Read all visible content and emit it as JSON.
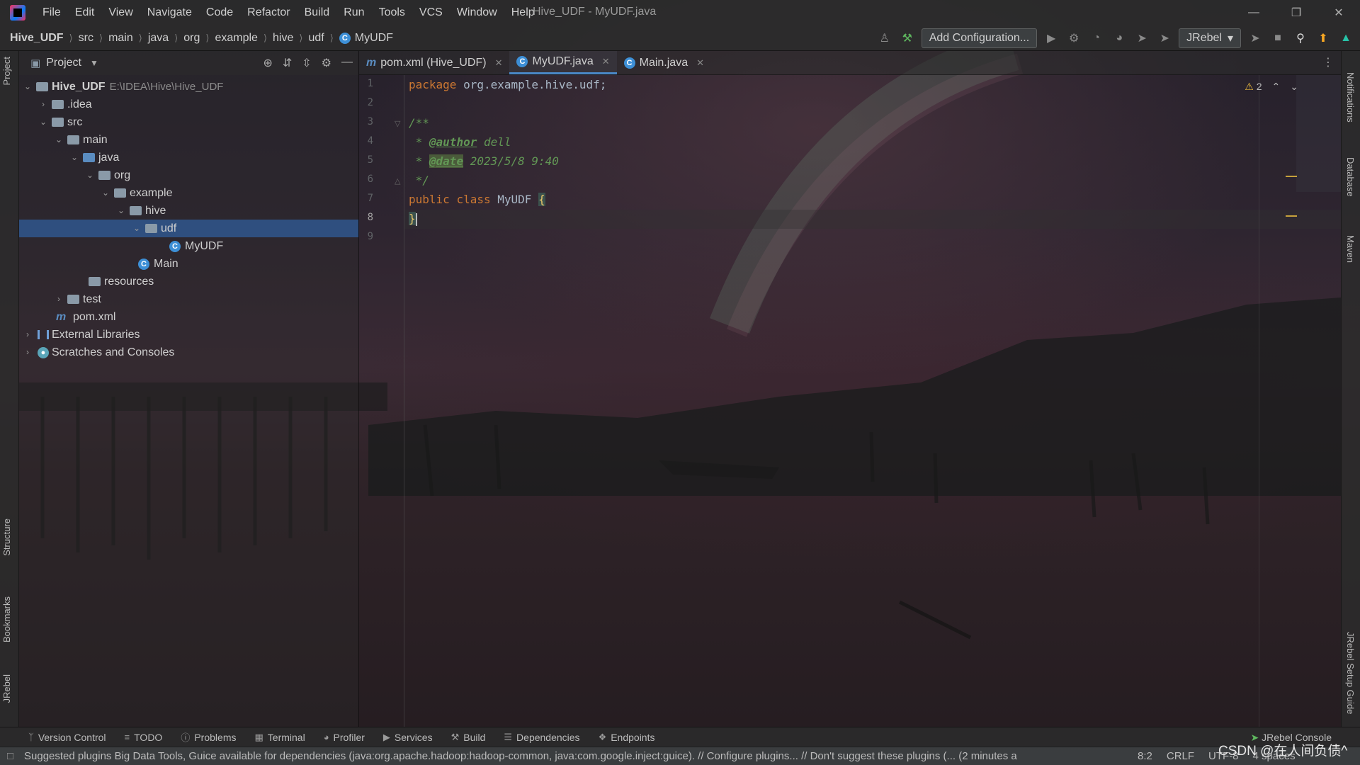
{
  "window": {
    "title": "Hive_UDF - MyUDF.java",
    "menu": [
      "File",
      "Edit",
      "View",
      "Navigate",
      "Code",
      "Refactor",
      "Build",
      "Run",
      "Tools",
      "VCS",
      "Window",
      "Help"
    ]
  },
  "breadcrumbs": [
    "Hive_UDF",
    "src",
    "main",
    "java",
    "org",
    "example",
    "hive",
    "udf",
    "MyUDF"
  ],
  "navbar": {
    "add_config": "Add Configuration...",
    "jrebel": "JRebel"
  },
  "left_strip": [
    "Project",
    "Structure",
    "Bookmarks",
    "JRebel"
  ],
  "right_strip": [
    "Notifications",
    "Database",
    "Maven",
    "JRebel Setup Guide"
  ],
  "project": {
    "header": "Project",
    "root": {
      "name": "Hive_UDF",
      "path": "E:\\IDEA\\Hive\\Hive_UDF"
    },
    "items": [
      ".idea",
      "src",
      "main",
      "java",
      "org",
      "example",
      "hive",
      "udf",
      "MyUDF",
      "Main",
      "resources",
      "test",
      "pom.xml",
      "External Libraries",
      "Scratches and Consoles"
    ]
  },
  "tabs": [
    {
      "label": "pom.xml (Hive_UDF)",
      "icon": "maven-icon"
    },
    {
      "label": "MyUDF.java",
      "icon": "class-icon"
    },
    {
      "label": "Main.java",
      "icon": "class-icon"
    }
  ],
  "editor": {
    "line_numbers": [
      "1",
      "2",
      "3",
      "4",
      "5",
      "6",
      "7",
      "8",
      "9"
    ],
    "current_line": "8",
    "warnings": "2",
    "code": {
      "l1_kw": "package",
      "l1_rest": " org.example.hive.udf;",
      "l3": "/**",
      "l4_pre": " * ",
      "l4_tag": "@author",
      "l4_val": " dell",
      "l5_pre": " * ",
      "l5_tag": "@date",
      "l5_val": " 2023/5/8 9:40",
      "l6": " */",
      "l7_kw1": "public",
      "l7_kw2": "class",
      "l7_name": "MyUDF",
      "l7_brace": "{",
      "l8_brace": "}"
    }
  },
  "bottom_tools": [
    "Version Control",
    "TODO",
    "Problems",
    "Terminal",
    "Profiler",
    "Services",
    "Build",
    "Dependencies",
    "Endpoints"
  ],
  "jrebel_console": "JRebel Console",
  "status": {
    "message": "Suggested plugins Big Data Tools, Guice available for dependencies (java:org.apache.hadoop:hadoop-common, java:com.google.inject:guice). // Configure plugins... // Don't suggest these plugins (... (2 minutes a",
    "position": "8:2",
    "line_sep": "CRLF",
    "encoding": "UTF-8",
    "indent": "4 spaces"
  },
  "watermark": "CSDN @在人间负债^"
}
